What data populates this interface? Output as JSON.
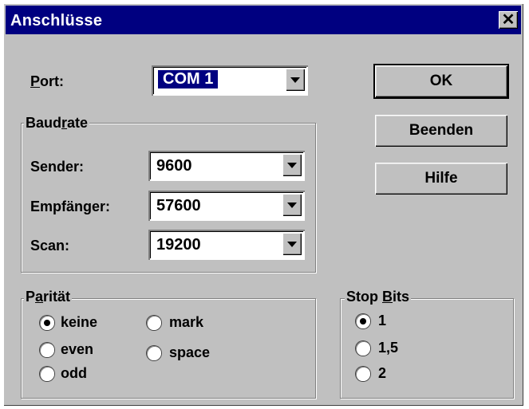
{
  "window": {
    "title": "Anschlüsse",
    "close_glyph": "✕"
  },
  "port": {
    "label_key": "P",
    "label_rest": "ort:",
    "value": "COM 1"
  },
  "baudrate": {
    "legend_pre": "Baud",
    "legend_key": "r",
    "legend_post": "ate",
    "sender_label": "Sender:",
    "sender_value": "9600",
    "receiver_label": "Empfänger:",
    "receiver_value": "57600",
    "scan_label": "Scan:",
    "scan_value": "19200"
  },
  "buttons": {
    "ok": "OK",
    "quit": "Beenden",
    "help": "Hilfe"
  },
  "parity": {
    "legend_pre": "P",
    "legend_key": "a",
    "legend_post": "rität",
    "options": [
      "keine",
      "mark",
      "even",
      "space",
      "odd"
    ],
    "selected": "keine"
  },
  "stopbits": {
    "legend_pre": "Stop ",
    "legend_key": "B",
    "legend_post": "its",
    "options": [
      "1",
      "1,5",
      "2"
    ],
    "selected": "1"
  },
  "icons": {
    "close": "close-icon",
    "dropdown": "chevron-down-icon"
  },
  "colors": {
    "titlebar": "#000080",
    "face": "#c0c0c0",
    "selection": "#000080"
  }
}
